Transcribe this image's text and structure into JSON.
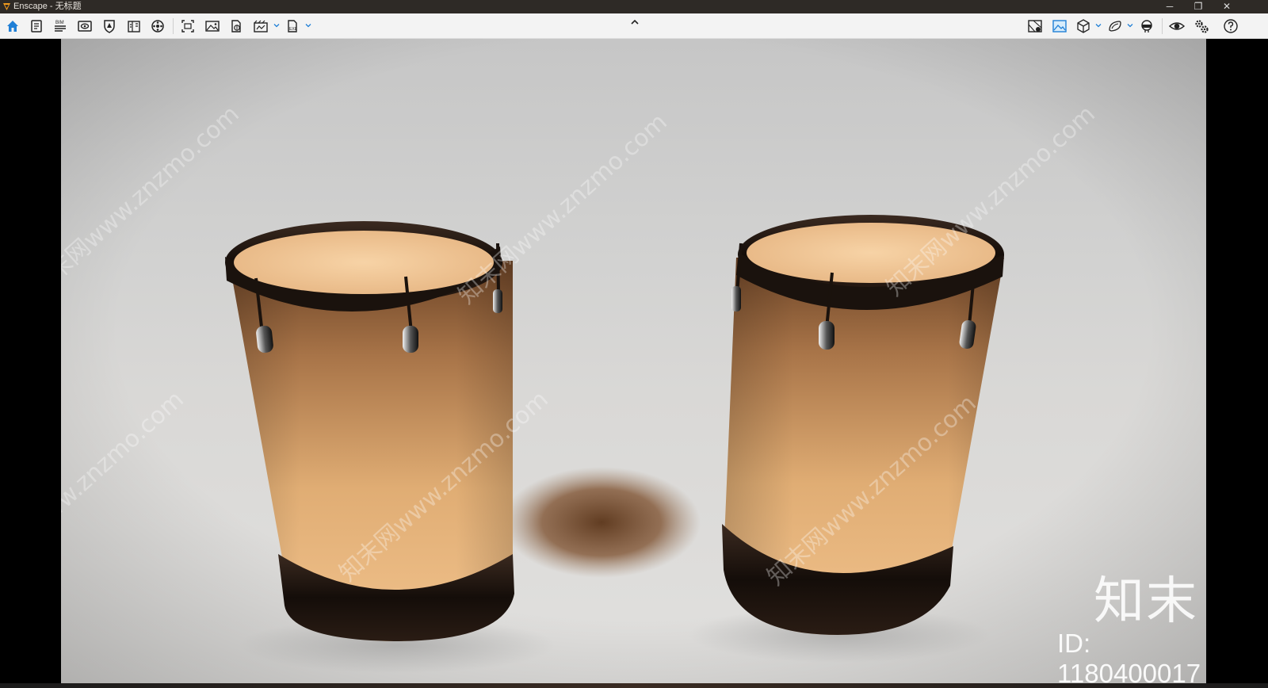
{
  "window": {
    "title": "Enscape - 无标题",
    "buttons": {
      "minimize": "─",
      "restore": "❐",
      "close": "✕"
    }
  },
  "toolbar": {
    "left_icons": [
      "home-icon",
      "projects-icon",
      "bim-icon",
      "views-icon",
      "visual-settings-icon",
      "assets-icon",
      "site-context-icon",
      "materials-icon",
      "screenshot-icon",
      "image-icon",
      "panorama-icon",
      "video-icon",
      "export-icon"
    ],
    "right_icons": [
      "map-icon",
      "image-view-icon",
      "cube-view-icon",
      "vr-icon",
      "headset-icon",
      "eye-icon",
      "settings-icon",
      "help-icon"
    ]
  },
  "viewport": {
    "watermark_brand": "知末",
    "watermark_id": "ID: 1180400017",
    "watermark_diag": "知末网www.znzmo.com",
    "colors": {
      "drum_body": "#e9b67d",
      "drum_rim": "#1c1410",
      "backdrop": "#d6d5d3"
    }
  }
}
